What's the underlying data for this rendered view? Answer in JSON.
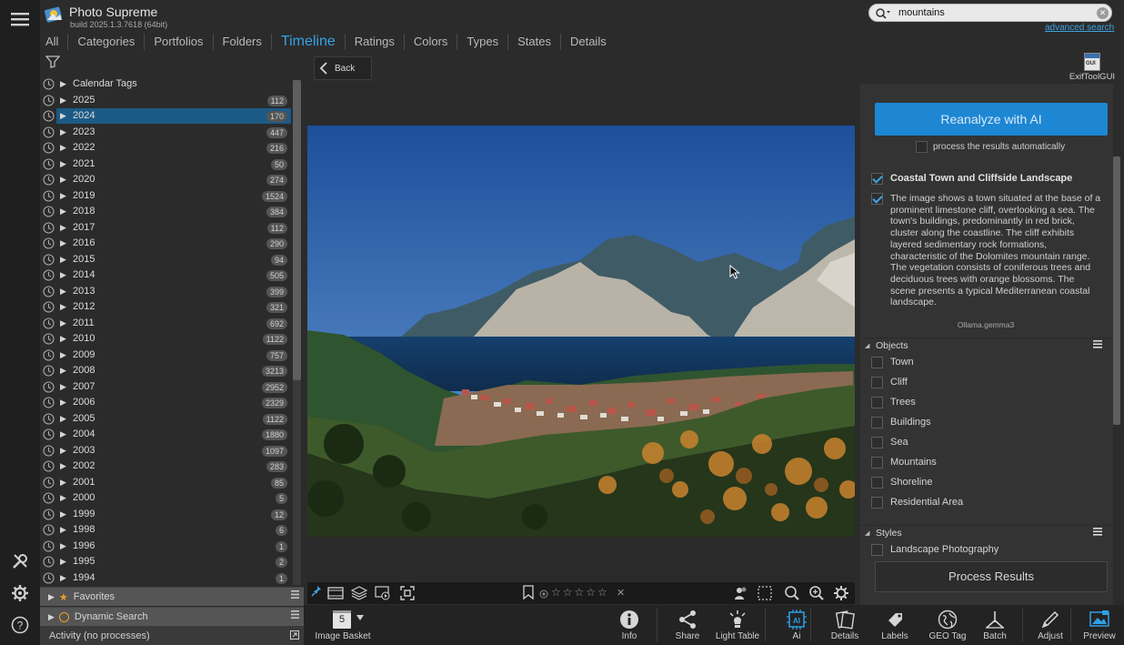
{
  "app": {
    "title": "Photo Supreme",
    "build": "build 2025.1.3.7618 (64bit)"
  },
  "nav": {
    "tabs": [
      "All",
      "Categories",
      "Portfolios",
      "Folders",
      "Timeline",
      "Ratings",
      "Colors",
      "Types",
      "States",
      "Details"
    ],
    "active": "Timeline"
  },
  "search": {
    "value": "mountains",
    "advanced_label": "advanced search"
  },
  "back_label": "Back",
  "tree": {
    "root": "Calendar Tags",
    "selected": "2024",
    "years": [
      {
        "year": "2025",
        "count": "112"
      },
      {
        "year": "2024",
        "count": "170"
      },
      {
        "year": "2023",
        "count": "447"
      },
      {
        "year": "2022",
        "count": "216"
      },
      {
        "year": "2021",
        "count": "50"
      },
      {
        "year": "2020",
        "count": "274"
      },
      {
        "year": "2019",
        "count": "1524"
      },
      {
        "year": "2018",
        "count": "384"
      },
      {
        "year": "2017",
        "count": "112"
      },
      {
        "year": "2016",
        "count": "290"
      },
      {
        "year": "2015",
        "count": "94"
      },
      {
        "year": "2014",
        "count": "505"
      },
      {
        "year": "2013",
        "count": "399"
      },
      {
        "year": "2012",
        "count": "321"
      },
      {
        "year": "2011",
        "count": "692"
      },
      {
        "year": "2010",
        "count": "1122"
      },
      {
        "year": "2009",
        "count": "757"
      },
      {
        "year": "2008",
        "count": "3213"
      },
      {
        "year": "2007",
        "count": "2952"
      },
      {
        "year": "2006",
        "count": "2329"
      },
      {
        "year": "2005",
        "count": "1122"
      },
      {
        "year": "2004",
        "count": "1880"
      },
      {
        "year": "2003",
        "count": "1097"
      },
      {
        "year": "2002",
        "count": "283"
      },
      {
        "year": "2001",
        "count": "85"
      },
      {
        "year": "2000",
        "count": "5"
      },
      {
        "year": "1999",
        "count": "12"
      },
      {
        "year": "1998",
        "count": "6"
      },
      {
        "year": "1996",
        "count": "1"
      },
      {
        "year": "1995",
        "count": "2"
      },
      {
        "year": "1994",
        "count": "1"
      }
    ]
  },
  "panels": {
    "favorites": "Favorites",
    "dynamic_search": "Dynamic Search",
    "activity": "Activity (no processes)"
  },
  "exif_tool": {
    "label": "ExifToolGUI",
    "icon_text": "GUI"
  },
  "ai": {
    "reanalyze_label": "Reanalyze with AI",
    "auto_label": "process the results automatically",
    "title": "Coastal Town and Cliffside Landscape",
    "description": "The image shows a town situated at the base of a prominent limestone cliff, overlooking a sea. The town's buildings, predominantly in red brick, cluster along the coastline. The cliff exhibits layered sedimentary rock formations, characteristic of the Dolomites mountain range. The vegetation consists of coniferous trees and deciduous trees with orange blossoms. The scene presents a typical Mediterranean coastal landscape.",
    "model": "Ollama.gemma3",
    "objects_title": "Objects",
    "objects": [
      "Town",
      "Cliff",
      "Trees",
      "Buildings",
      "Sea",
      "Mountains",
      "Shoreline",
      "Residential Area"
    ],
    "styles_title": "Styles",
    "styles": [
      "Landscape Photography"
    ],
    "process_label": "Process Results"
  },
  "basket": {
    "count": "5",
    "label": "Image Basket"
  },
  "bottom_tools": [
    "Info",
    "Share",
    "Light Table",
    "Ai",
    "Details",
    "Labels",
    "GEO Tag",
    "Batch",
    "Adjust",
    "Preview"
  ],
  "ai_icon_text": "AI",
  "colors": {
    "accent": "#33a3e6",
    "selection": "#1c5a86",
    "button_primary": "#1d87d4"
  }
}
